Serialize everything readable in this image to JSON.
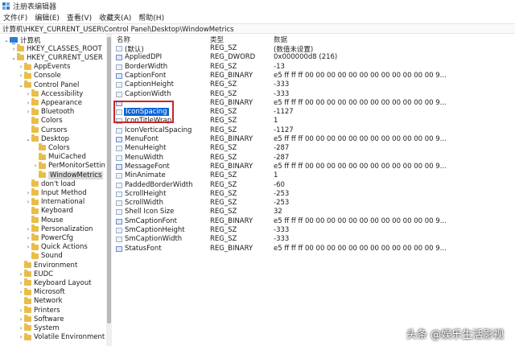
{
  "window": {
    "title": "注册表编辑器"
  },
  "menu": [
    "文件(F)",
    "编辑(E)",
    "查看(V)",
    "收藏夹(A)",
    "帮助(H)"
  ],
  "address": "计算机\\HKEY_CURRENT_USER\\Control Panel\\Desktop\\WindowMetrics",
  "tree": [
    {
      "label": "计算机",
      "level": 0,
      "caret": "open",
      "icon": "computer-icon"
    },
    {
      "label": "HKEY_CLASSES_ROOT",
      "level": 1,
      "caret": "closed",
      "icon": "folder-icon"
    },
    {
      "label": "HKEY_CURRENT_USER",
      "level": 1,
      "caret": "open",
      "icon": "folder-icon"
    },
    {
      "label": "AppEvents",
      "level": 2,
      "caret": "closed",
      "icon": "folder-icon"
    },
    {
      "label": "Console",
      "level": 2,
      "caret": "closed",
      "icon": "folder-icon"
    },
    {
      "label": "Control Panel",
      "level": 2,
      "caret": "open",
      "icon": "folder-icon"
    },
    {
      "label": "Accessibility",
      "level": 3,
      "caret": "closed",
      "icon": "folder-icon"
    },
    {
      "label": "Appearance",
      "level": 3,
      "caret": "closed",
      "icon": "folder-icon"
    },
    {
      "label": "Bluetooth",
      "level": 3,
      "caret": "closed",
      "icon": "folder-icon"
    },
    {
      "label": "Colors",
      "level": 3,
      "caret": "none",
      "icon": "folder-icon"
    },
    {
      "label": "Cursors",
      "level": 3,
      "caret": "none",
      "icon": "folder-icon"
    },
    {
      "label": "Desktop",
      "level": 3,
      "caret": "open",
      "icon": "folder-icon"
    },
    {
      "label": "Colors",
      "level": 4,
      "caret": "none",
      "icon": "folder-icon"
    },
    {
      "label": "MuiCached",
      "level": 4,
      "caret": "none",
      "icon": "folder-icon"
    },
    {
      "label": "PerMonitorSettin",
      "level": 4,
      "caret": "closed",
      "icon": "folder-icon"
    },
    {
      "label": "WindowMetrics",
      "level": 4,
      "caret": "none",
      "icon": "folder-icon",
      "selected": true
    },
    {
      "label": "don't load",
      "level": 3,
      "caret": "none",
      "icon": "folder-icon"
    },
    {
      "label": "Input Method",
      "level": 3,
      "caret": "closed",
      "icon": "folder-icon"
    },
    {
      "label": "International",
      "level": 3,
      "caret": "closed",
      "icon": "folder-icon"
    },
    {
      "label": "Keyboard",
      "level": 3,
      "caret": "none",
      "icon": "folder-icon"
    },
    {
      "label": "Mouse",
      "level": 3,
      "caret": "none",
      "icon": "folder-icon"
    },
    {
      "label": "Personalization",
      "level": 3,
      "caret": "closed",
      "icon": "folder-icon"
    },
    {
      "label": "PowerCfg",
      "level": 3,
      "caret": "closed",
      "icon": "folder-icon"
    },
    {
      "label": "Quick Actions",
      "level": 3,
      "caret": "closed",
      "icon": "folder-icon"
    },
    {
      "label": "Sound",
      "level": 3,
      "caret": "none",
      "icon": "folder-icon"
    },
    {
      "label": "Environment",
      "level": 2,
      "caret": "none",
      "icon": "folder-icon"
    },
    {
      "label": "EUDC",
      "level": 2,
      "caret": "closed",
      "icon": "folder-icon"
    },
    {
      "label": "Keyboard Layout",
      "level": 2,
      "caret": "closed",
      "icon": "folder-icon"
    },
    {
      "label": "Microsoft",
      "level": 2,
      "caret": "closed",
      "icon": "folder-icon"
    },
    {
      "label": "Network",
      "level": 2,
      "caret": "none",
      "icon": "folder-icon"
    },
    {
      "label": "Printers",
      "level": 2,
      "caret": "closed",
      "icon": "folder-icon"
    },
    {
      "label": "Software",
      "level": 2,
      "caret": "closed",
      "icon": "folder-icon"
    },
    {
      "label": "System",
      "level": 2,
      "caret": "closed",
      "icon": "folder-icon"
    },
    {
      "label": "Volatile Environment",
      "level": 2,
      "caret": "closed",
      "icon": "folder-icon"
    }
  ],
  "columns": {
    "name": "名称",
    "type": "类型",
    "data": "数据"
  },
  "values": [
    {
      "name": "(默认)",
      "type": "REG_SZ",
      "data": "(数值未设置)",
      "icon": "string-value-icon"
    },
    {
      "name": "AppliedDPI",
      "type": "REG_DWORD",
      "data": "0x000000d8 (216)",
      "icon": "binary-value-icon"
    },
    {
      "name": "BorderWidth",
      "type": "REG_SZ",
      "data": "-13",
      "icon": "string-value-icon"
    },
    {
      "name": "CaptionFont",
      "type": "REG_BINARY",
      "data": "e5 ff ff ff 00 00 00 00 00 00 00 00 00 00 00 00 9...",
      "icon": "binary-value-icon"
    },
    {
      "name": "CaptionHeight",
      "type": "REG_SZ",
      "data": "-333",
      "icon": "string-value-icon"
    },
    {
      "name": "CaptionWidth",
      "type": "REG_SZ",
      "data": "-333",
      "icon": "string-value-icon"
    },
    {
      "name": "",
      "type": "REG_BINARY",
      "data": "e5 ff ff ff 00 00 00 00 00 00 00 00 00 00 00 00 9...",
      "icon": "binary-value-icon"
    },
    {
      "name": "IconSpacing",
      "type": "REG_SZ",
      "data": "-1127",
      "icon": "string-value-icon",
      "selected": true
    },
    {
      "name": "IconTitleWrap",
      "type": "REG_SZ",
      "data": "1",
      "icon": "string-value-icon"
    },
    {
      "name": "IconVerticalSpacing",
      "type": "REG_SZ",
      "data": "-1127",
      "icon": "string-value-icon"
    },
    {
      "name": "MenuFont",
      "type": "REG_BINARY",
      "data": "e5 ff ff ff 00 00 00 00 00 00 00 00 00 00 00 00 9...",
      "icon": "binary-value-icon"
    },
    {
      "name": "MenuHeight",
      "type": "REG_SZ",
      "data": "-287",
      "icon": "string-value-icon"
    },
    {
      "name": "MenuWidth",
      "type": "REG_SZ",
      "data": "-287",
      "icon": "string-value-icon"
    },
    {
      "name": "MessageFont",
      "type": "REG_BINARY",
      "data": "e5 ff ff ff 00 00 00 00 00 00 00 00 00 00 00 00 9...",
      "icon": "binary-value-icon"
    },
    {
      "name": "MinAnimate",
      "type": "REG_SZ",
      "data": "1",
      "icon": "string-value-icon"
    },
    {
      "name": "PaddedBorderWidth",
      "type": "REG_SZ",
      "data": "-60",
      "icon": "string-value-icon"
    },
    {
      "name": "ScrollHeight",
      "type": "REG_SZ",
      "data": "-253",
      "icon": "string-value-icon"
    },
    {
      "name": "ScrollWidth",
      "type": "REG_SZ",
      "data": "-253",
      "icon": "string-value-icon"
    },
    {
      "name": "Shell Icon Size",
      "type": "REG_SZ",
      "data": "32",
      "icon": "string-value-icon"
    },
    {
      "name": "SmCaptionFont",
      "type": "REG_BINARY",
      "data": "e5 ff ff ff 00 00 00 00 00 00 00 00 00 00 00 00 9...",
      "icon": "binary-value-icon"
    },
    {
      "name": "SmCaptionHeight",
      "type": "REG_SZ",
      "data": "-333",
      "icon": "string-value-icon"
    },
    {
      "name": "SmCaptionWidth",
      "type": "REG_SZ",
      "data": "-333",
      "icon": "string-value-icon"
    },
    {
      "name": "StatusFont",
      "type": "REG_BINARY",
      "data": "e5 ff ff ff 00 00 00 00 00 00 00 00 00 00 00 00 9...",
      "icon": "binary-value-icon"
    }
  ],
  "watermark": "头条 @娱乐生活影视"
}
